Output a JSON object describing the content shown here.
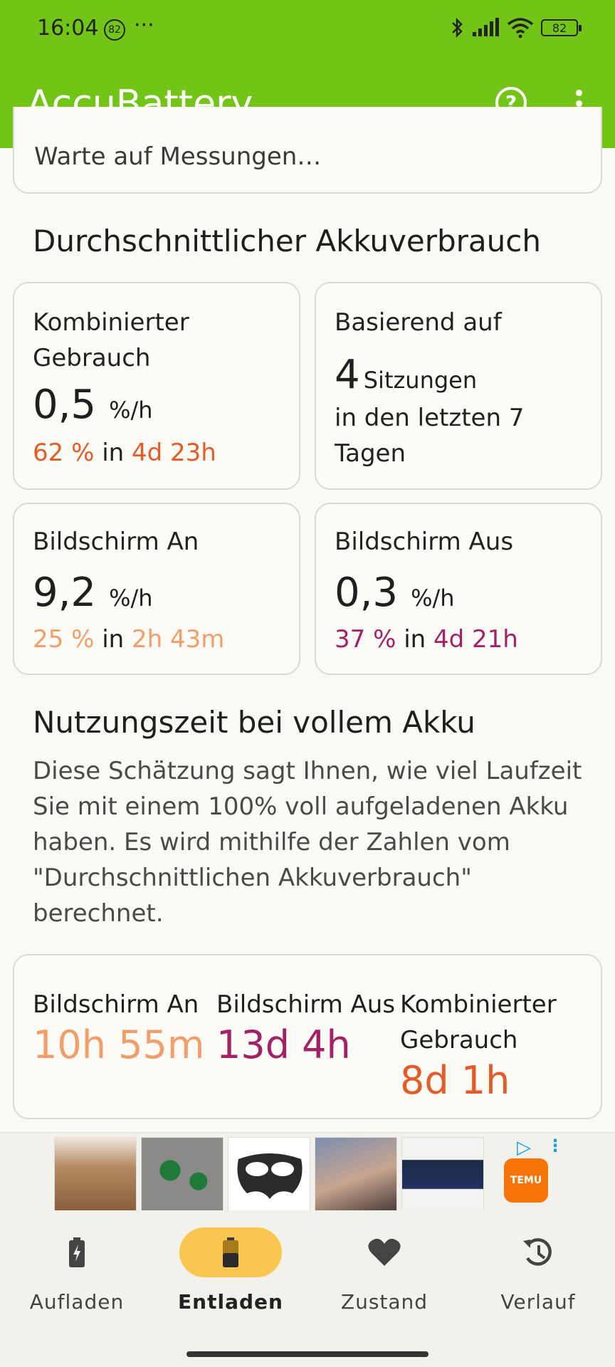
{
  "status_bar": {
    "time": "16:04",
    "notification_badge": "82",
    "overflow": "···",
    "battery": "82"
  },
  "app_bar": {
    "title": "AccuBattery",
    "help_icon": "help-circle-icon",
    "more_icon": "more-vert-icon"
  },
  "partial_card": {
    "text": "Warte auf Messungen…"
  },
  "average_usage": {
    "heading": "Durchschnittlicher Akkuverbrauch",
    "combined": {
      "label": "Kombinierter Gebrauch",
      "value": "0,5",
      "unit": "%/h",
      "percent": "62 %",
      "in": "in",
      "duration": "4d 23h"
    },
    "based_on": {
      "label": "Basierend auf",
      "count": "4",
      "sessions": "Sitzungen",
      "rest": "in den letzten 7 Tagen"
    },
    "screen_on": {
      "label": "Bildschirm An",
      "value": "9,2",
      "unit": "%/h",
      "percent": "25 %",
      "in": "in",
      "duration": "2h 43m"
    },
    "screen_off": {
      "label": "Bildschirm Aus",
      "value": "0,3",
      "unit": "%/h",
      "percent": "37 %",
      "in": "in",
      "duration": "4d 21h"
    }
  },
  "full_charge": {
    "heading": "Nutzungszeit bei vollem Akku",
    "description": "Diese Schätzung sagt Ihnen, wie viel Laufzeit Sie mit einem 100% voll aufgeladenen Akku haben. Es wird mithilfe der Zahlen vom \"Durchschnittlichen Akkuverbrauch\" berechnet.",
    "screen_on": {
      "label": "Bildschirm An",
      "value": "10h 55m"
    },
    "screen_off": {
      "label": "Bildschirm Aus",
      "value": "13d 4h"
    },
    "combined": {
      "label": "Kombinierter Gebrauch",
      "value": "8d 1h"
    }
  },
  "ad": {
    "brand": "TEMU"
  },
  "bottom_nav": [
    {
      "label": "Aufladen",
      "icon": "battery-charging-icon",
      "active": false
    },
    {
      "label": "Entladen",
      "icon": "battery-discharging-icon",
      "active": true
    },
    {
      "label": "Zustand",
      "icon": "heart-icon",
      "active": false
    },
    {
      "label": "Verlauf",
      "icon": "history-icon",
      "active": false
    }
  ],
  "colors": {
    "app_bar": "#72c516",
    "orange": "#e55b27",
    "peach": "#f29e6a",
    "purple": "#a32166",
    "active_pill": "#f9c74f"
  }
}
